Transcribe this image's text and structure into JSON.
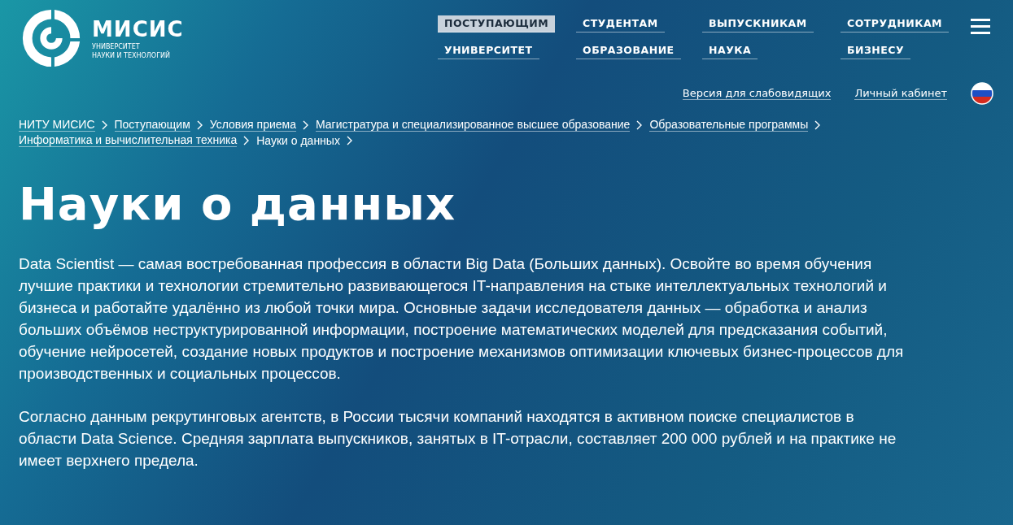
{
  "logo": {
    "name": "МИСИС",
    "subtitle_line1": "УНИВЕРСИТЕТ",
    "subtitle_line2": "НАУКИ И ТЕХНОЛОГИЙ"
  },
  "nav": [
    {
      "label": "ПОСТУПАЮЩИМ",
      "selected": true
    },
    {
      "label": "СТУДЕНТАМ",
      "selected": false
    },
    {
      "label": "ВЫПУСКНИКАМ",
      "selected": false
    },
    {
      "label": "СОТРУДНИКАМ",
      "selected": false
    },
    {
      "label": "УНИВЕРСИТЕТ",
      "selected": false
    },
    {
      "label": "ОБРАЗОВАНИЕ",
      "selected": false
    },
    {
      "label": "НАУКА",
      "selected": false
    },
    {
      "label": "БИЗНЕСУ",
      "selected": false
    }
  ],
  "utility_links": [
    "Версия для слабовидящих",
    "Личный кабинет"
  ],
  "breadcrumbs": [
    {
      "label": "НИТУ МИСИС",
      "link": true
    },
    {
      "label": "Поступающим",
      "link": true
    },
    {
      "label": "Условия приема",
      "link": true
    },
    {
      "label": "Магистратура и специализированное высшее образование",
      "link": true
    },
    {
      "label": "Образовательные программы",
      "link": true
    },
    {
      "label": "Информатика и вычислительная техника",
      "link": true
    },
    {
      "label": "Науки о данных",
      "link": false
    }
  ],
  "title": "Науки о данных",
  "paragraphs": [
    "Data Scientist — самая востребованная профессия в области Big Data (Больших данных). Освойте во время обучения лучшие практики и технологии стремительно развивающегося IT-направления на стыке интеллектуальных технологий и бизнеса и работайте удалённо из любой точки мира. Основные задачи исследователя данных — обработка и анализ больших объёмов неструктурированной информации, построение математических моделей для предсказания событий, обучение нейросетей, создание новых продуктов и построение механизмов оптимизации ключевых бизнес-процессов для производственных и социальных процессов.",
    "Согласно данным рекрутинговых агентств, в России тысячи компаний находятся в активном поиске специалистов в области Data Science. Средняя зарплата выпускников, занятых в IT-отрасли, составляет 200 000 рублей и на практике не имеет верхнего предела."
  ]
}
